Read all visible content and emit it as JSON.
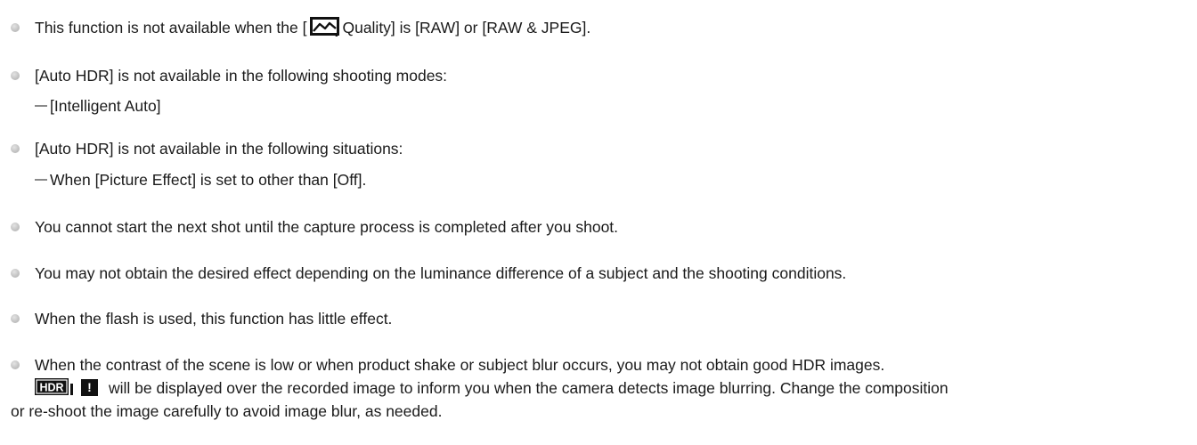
{
  "notes": [
    {
      "text_before": "This function is not available when the [",
      "icon": "image-quality-icon",
      "text_after": "Quality] is [RAW] or [RAW & JPEG]."
    },
    {
      "text": "[Auto HDR] is not available in the following shooting modes:",
      "subitems": [
        "[Intelligent Auto]"
      ]
    },
    {
      "text": "[Auto HDR] is not available in the following situations:",
      "subitems": [
        "When [Picture Effect] is set to other than [Off]."
      ]
    },
    {
      "text": "You cannot start the next shot until the capture process is completed after you shoot."
    },
    {
      "text": "You may not obtain the desired effect depending on the luminance difference of a subject and the shooting conditions."
    },
    {
      "text": "When the flash is used, this function has little effect."
    },
    {
      "text": "When the contrast of the scene is low or when product shake or subject blur occurs, you may not obtain good HDR images.",
      "icons": [
        "hdr-icon",
        "warning-icon"
      ],
      "hdr_label": "HDR",
      "warning_label": "!",
      "continuation": "will be displayed over the recorded image to inform you when the camera detects image blurring. Change the composition",
      "continuation_2": "or re-shoot the image carefully to avoid image blur, as needed."
    }
  ]
}
